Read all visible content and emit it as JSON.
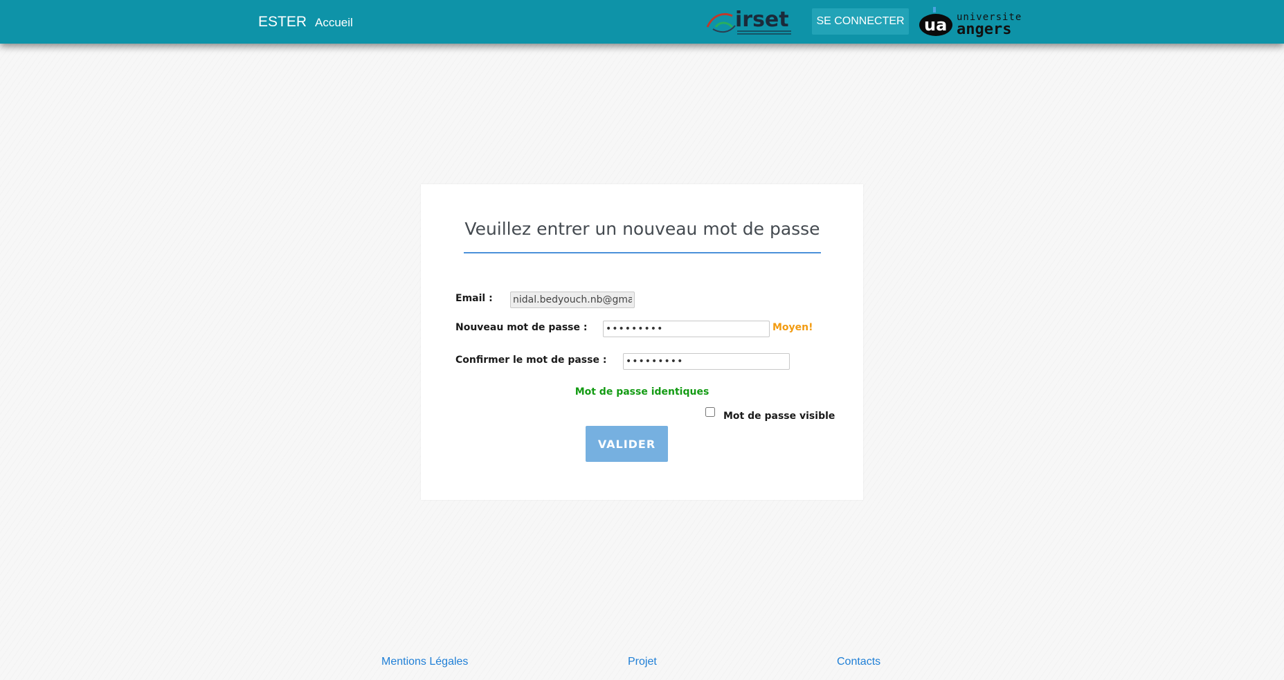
{
  "navbar": {
    "brand": "ESTER",
    "home_link": "Accueil",
    "login_button": "SE CONNECTER",
    "logo_irset_text": "irset",
    "logo_ua_text": "universite angers",
    "background": "#0e93a8"
  },
  "form": {
    "title": "Veuillez entrer un nouveau mot de passe",
    "email_label": "Email :",
    "email_value": "nidal.bedyouch.nb@gmail.com",
    "new_password_label": "Nouveau mot de passe :",
    "new_password_value": "•••••••••",
    "strength_text": "Moyen!",
    "confirm_password_label": "Confirmer le mot de passe :",
    "confirm_password_value": "•••••••••",
    "match_text": "Mot de passe identiques",
    "show_password_label": "Mot de passe visible",
    "show_password_checked": false,
    "submit_label": "VALIDER",
    "accent_color": "#4a90d9",
    "strength_color": "#f29b11",
    "match_color": "#139b13"
  },
  "footer": {
    "links": [
      "Mentions Légales",
      "Projet",
      "Contacts"
    ],
    "link_color": "#1f7fd6"
  }
}
